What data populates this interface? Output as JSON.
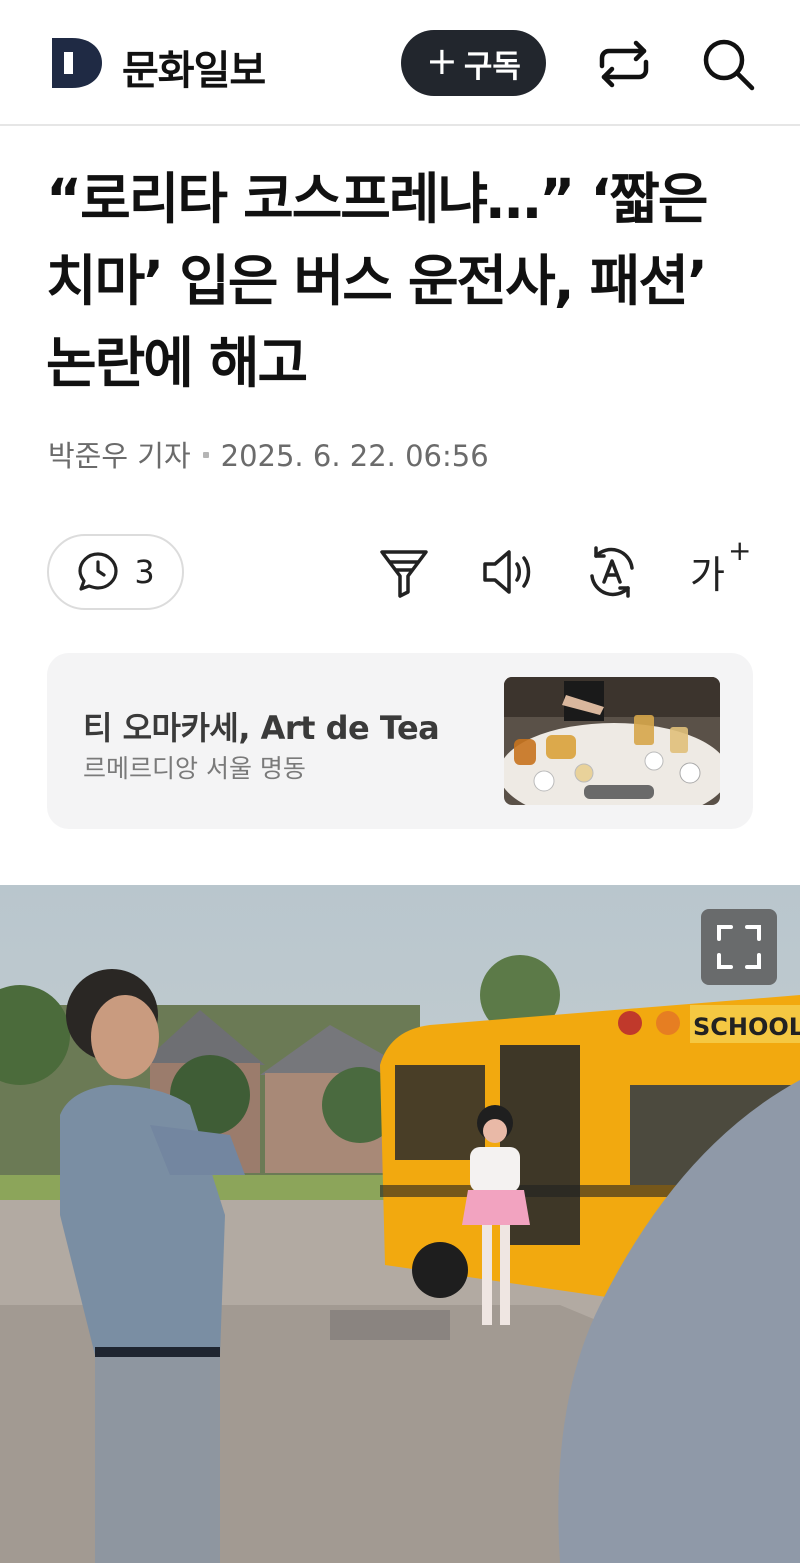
{
  "header": {
    "brand": "문화일보",
    "logo_letter": "D",
    "subscribe_plus": "+",
    "subscribe_label": "구독",
    "share_icon": "share-icon",
    "search_icon": "search-icon"
  },
  "article": {
    "title": "“로리타 코스프레냐…” ‘짧은 치마’ 입은 버스 운전사, 패션’ 논란에 해고",
    "author": "박준우 기자",
    "date": "2025. 6. 22. 06:56"
  },
  "toolbar": {
    "comment_count": "3",
    "font_size_label": "가",
    "font_size_plus": "+",
    "icons": [
      "comment-icon",
      "filter-icon",
      "speaker-icon",
      "translate-icon",
      "font-size-icon"
    ]
  },
  "ad": {
    "title": "티 오마카세, Art de Tea",
    "subtitle": "르메르디앙 서울 명동"
  },
  "photo": {
    "bus_sign": "SCHOOL BUS",
    "expand_icon": "expand-icon"
  },
  "colors": {
    "brand_navy": "#1f2a44",
    "subscribe_bg": "#22262d",
    "bus_yellow": "#f2a90f"
  }
}
